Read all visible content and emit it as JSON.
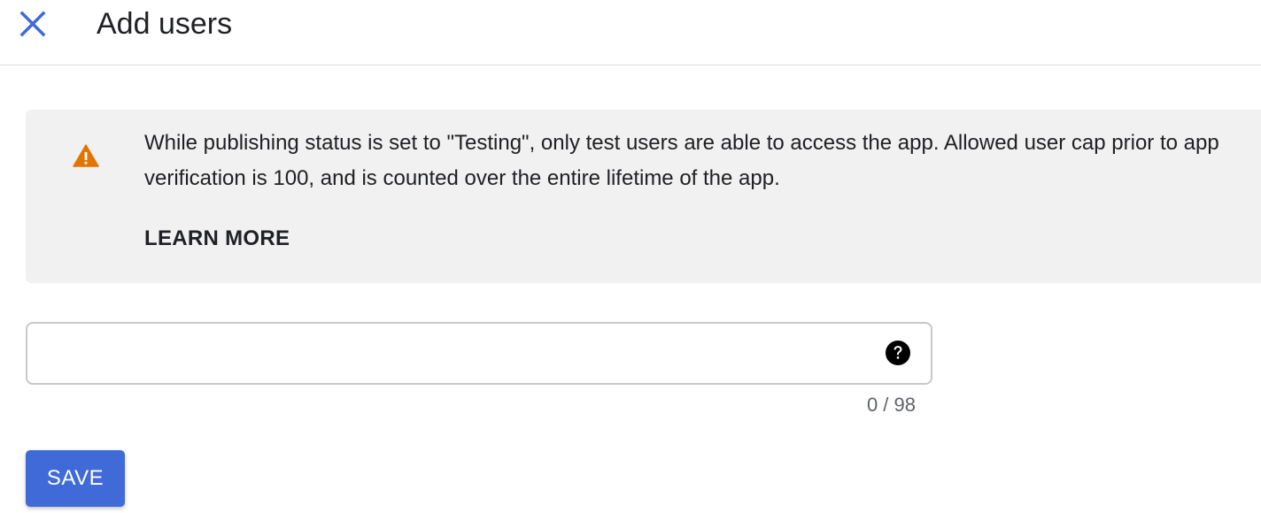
{
  "header": {
    "title": "Add users",
    "close_icon": "close-icon",
    "accent_color": "#3f6ad8"
  },
  "banner": {
    "icon": "warning-icon",
    "icon_color": "#e37400",
    "message": "While publishing status is set to \"Testing\", only test users are able to access the app. Allowed user cap prior to app verification is 100, and is counted over the entire lifetime of the app.",
    "link_label": "LEARN MORE"
  },
  "users_input": {
    "value": "",
    "placeholder": "",
    "help_icon": "help-icon",
    "counter": "0 / 98"
  },
  "actions": {
    "save_label": "SAVE",
    "save_color": "#3f6ad8"
  }
}
